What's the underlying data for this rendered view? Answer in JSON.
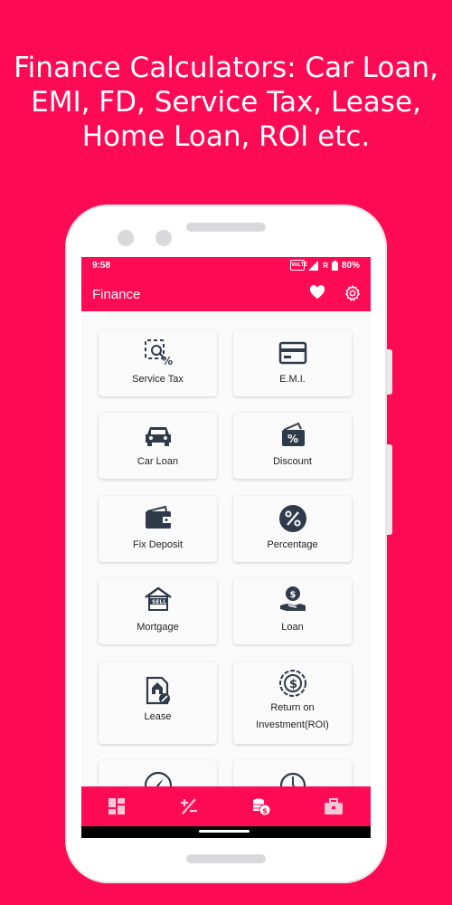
{
  "promo": {
    "lines": [
      "Finance Calculators: Car Loan,",
      "EMI, FD, Service Tax, Lease,",
      "Home Loan, ROI etc."
    ]
  },
  "status_bar": {
    "time": "9:58",
    "volte": "VoLTE",
    "roaming": "R",
    "battery": "80%"
  },
  "app_bar": {
    "title": "Finance",
    "favorite_icon": "heart-icon",
    "settings_icon": "gear-icon"
  },
  "grid": {
    "items": [
      {
        "label": "Service Tax",
        "icon": "service-tax-icon"
      },
      {
        "label": "E.M.I.",
        "icon": "credit-card-icon"
      },
      {
        "label": "Car Loan",
        "icon": "car-icon"
      },
      {
        "label": "Discount",
        "icon": "discount-tag-icon"
      },
      {
        "label": "Fix Deposit",
        "icon": "wallet-icon"
      },
      {
        "label": "Percentage",
        "icon": "percent-icon"
      },
      {
        "label": "Mortgage",
        "icon": "house-sell-icon"
      },
      {
        "label": "Loan",
        "icon": "hand-coin-icon"
      },
      {
        "label": "Lease",
        "icon": "lease-document-icon"
      },
      {
        "label": "Return on",
        "label2": "Investment(ROI)",
        "icon": "roi-coin-icon"
      },
      {
        "label": "",
        "icon": "compass-icon"
      },
      {
        "label": "",
        "icon": "timer-icon"
      }
    ]
  },
  "bottom_nav": {
    "items": [
      "dashboard-icon",
      "plus-minus-icon",
      "coins-icon",
      "briefcase-icon"
    ],
    "active_index": 2
  },
  "colors": {
    "brand": "#ff0a55",
    "icon": "#2f3a4a"
  }
}
